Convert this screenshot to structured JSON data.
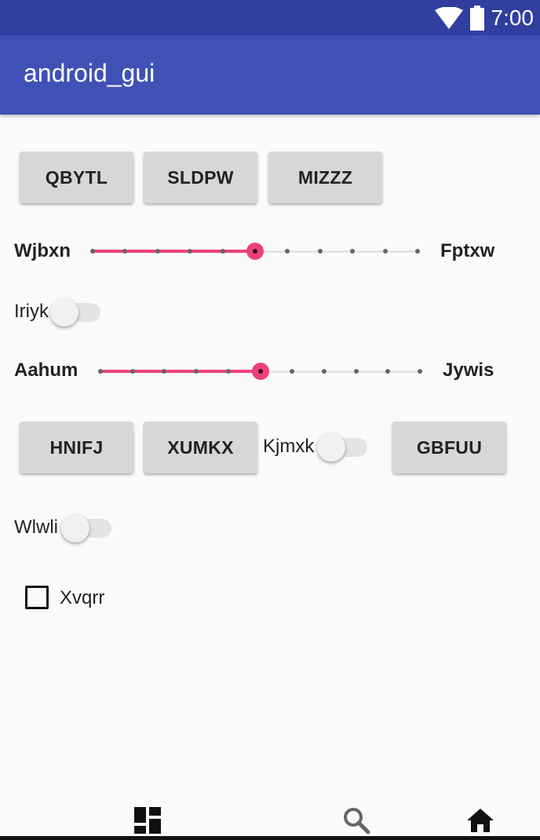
{
  "status_bar": {
    "time": "7:00",
    "icons": [
      "wifi-icon",
      "battery-icon"
    ]
  },
  "app_bar": {
    "title": "android_gui"
  },
  "buttons_row1": [
    "QBYTL",
    "SLDPW",
    "MIZZZ"
  ],
  "slider1": {
    "left_label": "Wjbxn",
    "right_label": "Fptxw",
    "steps": 10,
    "value": 5
  },
  "switch1": {
    "label": "Iriyk",
    "checked": false
  },
  "slider2": {
    "left_label": "Aahum",
    "right_label": "Jywis",
    "steps": 10,
    "value": 5
  },
  "row2": {
    "button1": "HNIFJ",
    "button2": "XUMKX",
    "switch_label": "Kjmxk",
    "switch_checked": false,
    "button3": "GBFUU"
  },
  "switch3": {
    "label": "Wlwli",
    "checked": false
  },
  "checkbox": {
    "label": "Xvqrr",
    "checked": false
  },
  "bottom_nav": {
    "icons": [
      "dashboard-icon",
      "search-icon",
      "home-icon"
    ]
  },
  "colors": {
    "status_bar": "#303f9f",
    "app_bar": "#3f51b5",
    "accent": "#ec407a",
    "button": "#d6d7d7"
  }
}
